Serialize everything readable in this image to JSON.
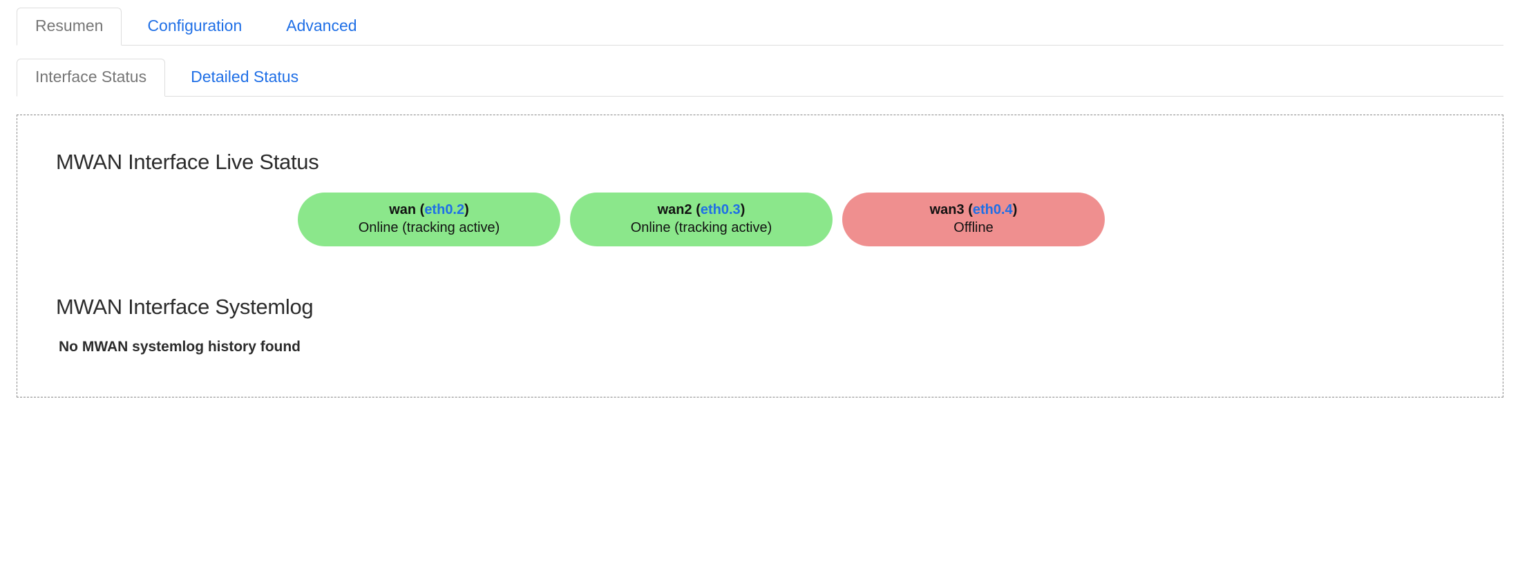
{
  "main_tabs": {
    "items": [
      {
        "label": "Resumen",
        "active": true
      },
      {
        "label": "Configuration",
        "active": false
      },
      {
        "label": "Advanced",
        "active": false
      }
    ]
  },
  "sub_tabs": {
    "items": [
      {
        "label": "Interface Status",
        "active": true
      },
      {
        "label": "Detailed Status",
        "active": false
      }
    ]
  },
  "live_status": {
    "heading": "MWAN Interface Live Status",
    "interfaces": [
      {
        "name": "wan",
        "iface": "eth0.2",
        "status_text": "Online (tracking active)",
        "state": "online"
      },
      {
        "name": "wan2",
        "iface": "eth0.3",
        "status_text": "Online (tracking active)",
        "state": "online"
      },
      {
        "name": "wan3",
        "iface": "eth0.4",
        "status_text": "Offline",
        "state": "offline"
      }
    ]
  },
  "systemlog": {
    "heading": "MWAN Interface Systemlog",
    "empty_message": "No MWAN systemlog history found"
  }
}
